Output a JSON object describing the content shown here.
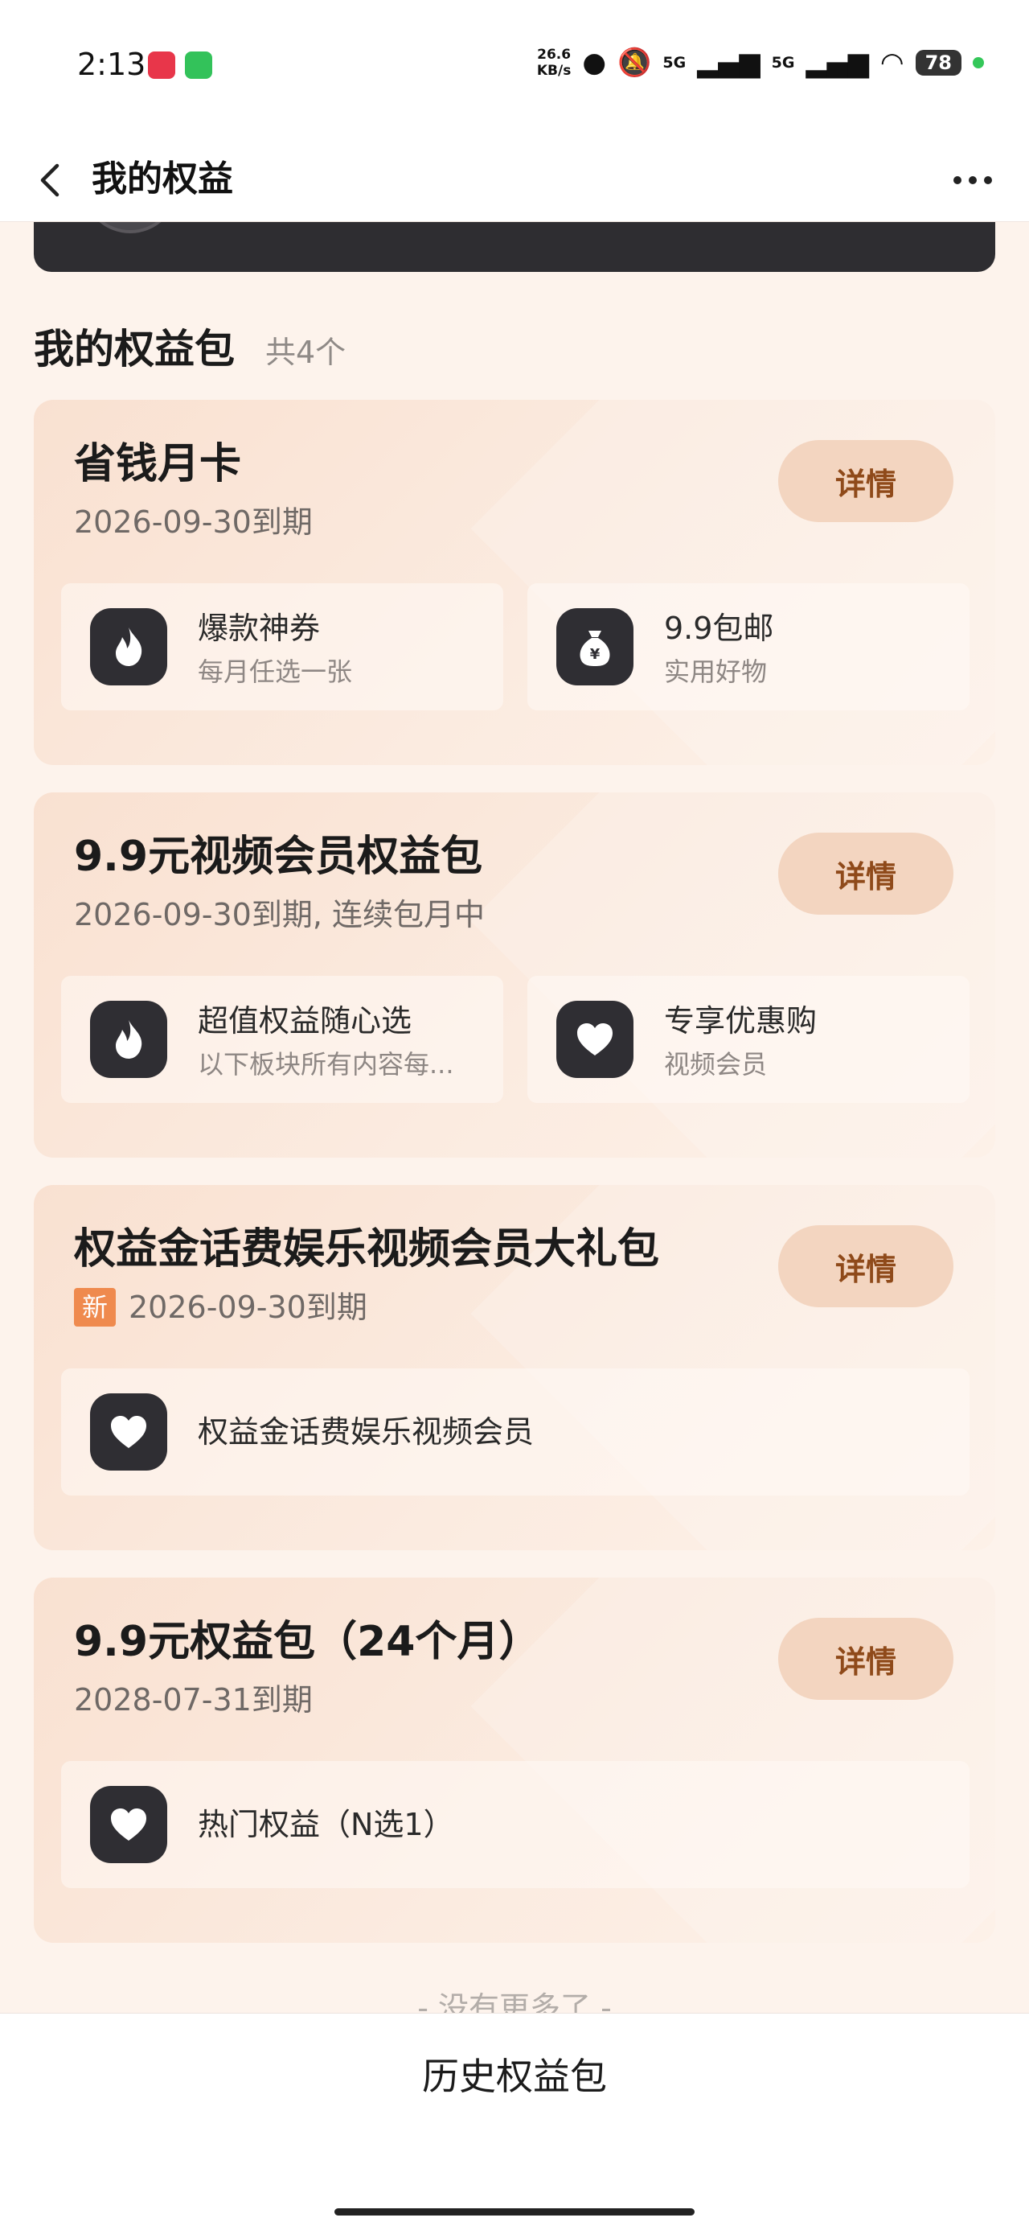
{
  "status_bar": {
    "time": "2:13",
    "net_speed_value": "26.6",
    "net_speed_unit": "KB/s",
    "network_1": "5G",
    "network_2": "5G",
    "battery": "78",
    "colors": {
      "dot": "#34c759"
    }
  },
  "nav": {
    "title": "我的权益"
  },
  "section": {
    "title": "我的权益包",
    "count": "共4个"
  },
  "packs": [
    {
      "name": "省钱月卡",
      "expiry": "2026-09-30到期",
      "detail_label": "详情",
      "benefits": [
        {
          "icon": "flame-icon",
          "title": "爆款神券",
          "subtitle": "每月任选一张"
        },
        {
          "icon": "money-bag-icon",
          "title": "9.9包邮",
          "subtitle": "实用好物"
        }
      ]
    },
    {
      "name": "9.9元视频会员权益包",
      "expiry": "2026-09-30到期, 连续包月中",
      "detail_label": "详情",
      "benefits": [
        {
          "icon": "flame-icon",
          "title": "超值权益随心选",
          "subtitle": "以下板块所有内容每..."
        },
        {
          "icon": "heart-icon",
          "title": "专享优惠购",
          "subtitle": "视频会员"
        }
      ]
    },
    {
      "name": "权益金话费娱乐视频会员大礼包",
      "badge": "新",
      "expiry": "2026-09-30到期",
      "detail_label": "详情",
      "benefits": [
        {
          "icon": "heart-icon",
          "title": "权益金话费娱乐视频会员"
        }
      ]
    },
    {
      "name": "9.9元权益包（24个月）",
      "expiry": "2028-07-31到期",
      "detail_label": "详情",
      "benefits": [
        {
          "icon": "heart-icon",
          "title": "热门权益（N选1）"
        }
      ]
    }
  ],
  "footer": {
    "no_more": "- 没有更多了 -",
    "history_label": "历史权益包"
  },
  "colors": {
    "accent_text": "#8f4a1a",
    "button_bg": "#f3d5c0",
    "icon_bg": "#2f2e33",
    "new_badge": "#ef8a4e"
  }
}
